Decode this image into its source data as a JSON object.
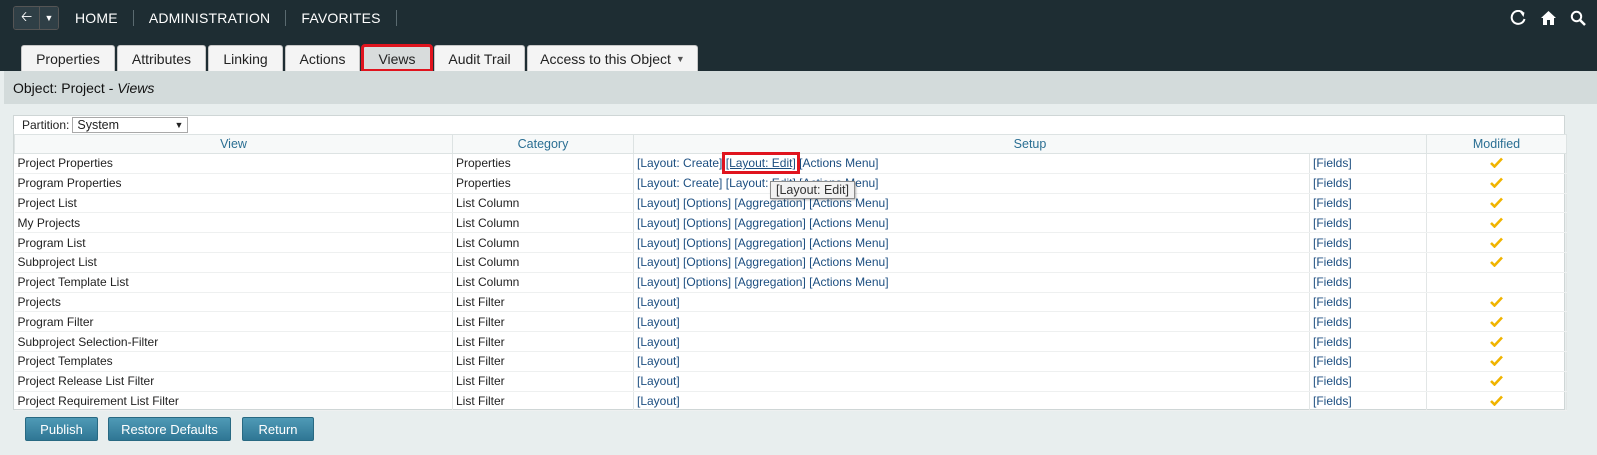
{
  "topnav": {
    "items": [
      "HOME",
      "ADMINISTRATION",
      "FAVORITES"
    ]
  },
  "tabs": [
    "Properties",
    "Attributes",
    "Linking",
    "Actions",
    "Views",
    "Audit Trail",
    "Access to this Object"
  ],
  "title": {
    "prefix": "Object: Project - ",
    "view": "Views"
  },
  "partition": {
    "label": "Partition:",
    "value": "System"
  },
  "table": {
    "headers": [
      "View",
      "Category",
      "Setup",
      "Modified"
    ],
    "rows": [
      {
        "view": "Project Properties",
        "category": "Properties",
        "setup": [
          "[Layout: Create]",
          "[Layout: Edit]",
          "[Actions Menu]"
        ],
        "fields": "[Fields]",
        "modified": true
      },
      {
        "view": "Program Properties",
        "category": "Properties",
        "setup": [
          "[Layout: Create]",
          "[Layout: Edit]",
          "[Actions Menu]"
        ],
        "fields": "[Fields]",
        "modified": true
      },
      {
        "view": "Project List",
        "category": "List Column",
        "setup": [
          "[Layout]",
          "[Options]",
          "[Aggregation]",
          "[Actions Menu]"
        ],
        "fields": "[Fields]",
        "modified": true
      },
      {
        "view": "My Projects",
        "category": "List Column",
        "setup": [
          "[Layout]",
          "[Options]",
          "[Aggregation]",
          "[Actions Menu]"
        ],
        "fields": "[Fields]",
        "modified": true
      },
      {
        "view": "Program List",
        "category": "List Column",
        "setup": [
          "[Layout]",
          "[Options]",
          "[Aggregation]",
          "[Actions Menu]"
        ],
        "fields": "[Fields]",
        "modified": true
      },
      {
        "view": "Subproject List",
        "category": "List Column",
        "setup": [
          "[Layout]",
          "[Options]",
          "[Aggregation]",
          "[Actions Menu]"
        ],
        "fields": "[Fields]",
        "modified": true
      },
      {
        "view": "Project Template List",
        "category": "List Column",
        "setup": [
          "[Layout]",
          "[Options]",
          "[Aggregation]",
          "[Actions Menu]"
        ],
        "fields": "[Fields]",
        "modified": false
      },
      {
        "view": "Projects",
        "category": "List Filter",
        "setup": [
          "[Layout]"
        ],
        "fields": "[Fields]",
        "modified": true
      },
      {
        "view": "Program Filter",
        "category": "List Filter",
        "setup": [
          "[Layout]"
        ],
        "fields": "[Fields]",
        "modified": true
      },
      {
        "view": "Subproject Selection-Filter",
        "category": "List Filter",
        "setup": [
          "[Layout]"
        ],
        "fields": "[Fields]",
        "modified": true
      },
      {
        "view": "Project Templates",
        "category": "List Filter",
        "setup": [
          "[Layout]"
        ],
        "fields": "[Fields]",
        "modified": true
      },
      {
        "view": "Project Release List Filter",
        "category": "List Filter",
        "setup": [
          "[Layout]"
        ],
        "fields": "[Fields]",
        "modified": true
      },
      {
        "view": "Project Requirement List Filter",
        "category": "List Filter",
        "setup": [
          "[Layout]"
        ],
        "fields": "[Fields]",
        "modified": true
      }
    ]
  },
  "tooltip": "[Layout: Edit]",
  "buttons": {
    "publish": "Publish",
    "restore": "Restore Defaults",
    "return": "Return"
  },
  "icons": {
    "back": "arrow-left-icon",
    "dropdown": "caret-down-icon",
    "refresh": "refresh-icon",
    "home": "home-icon",
    "search": "search-icon",
    "check": "check-icon"
  },
  "colors": {
    "topbar": "#1e2d33",
    "link": "#1c4e80",
    "header_text": "#2b6f93",
    "check": "#f0b400",
    "highlight": "#e0141e",
    "button": "#2f7694"
  }
}
